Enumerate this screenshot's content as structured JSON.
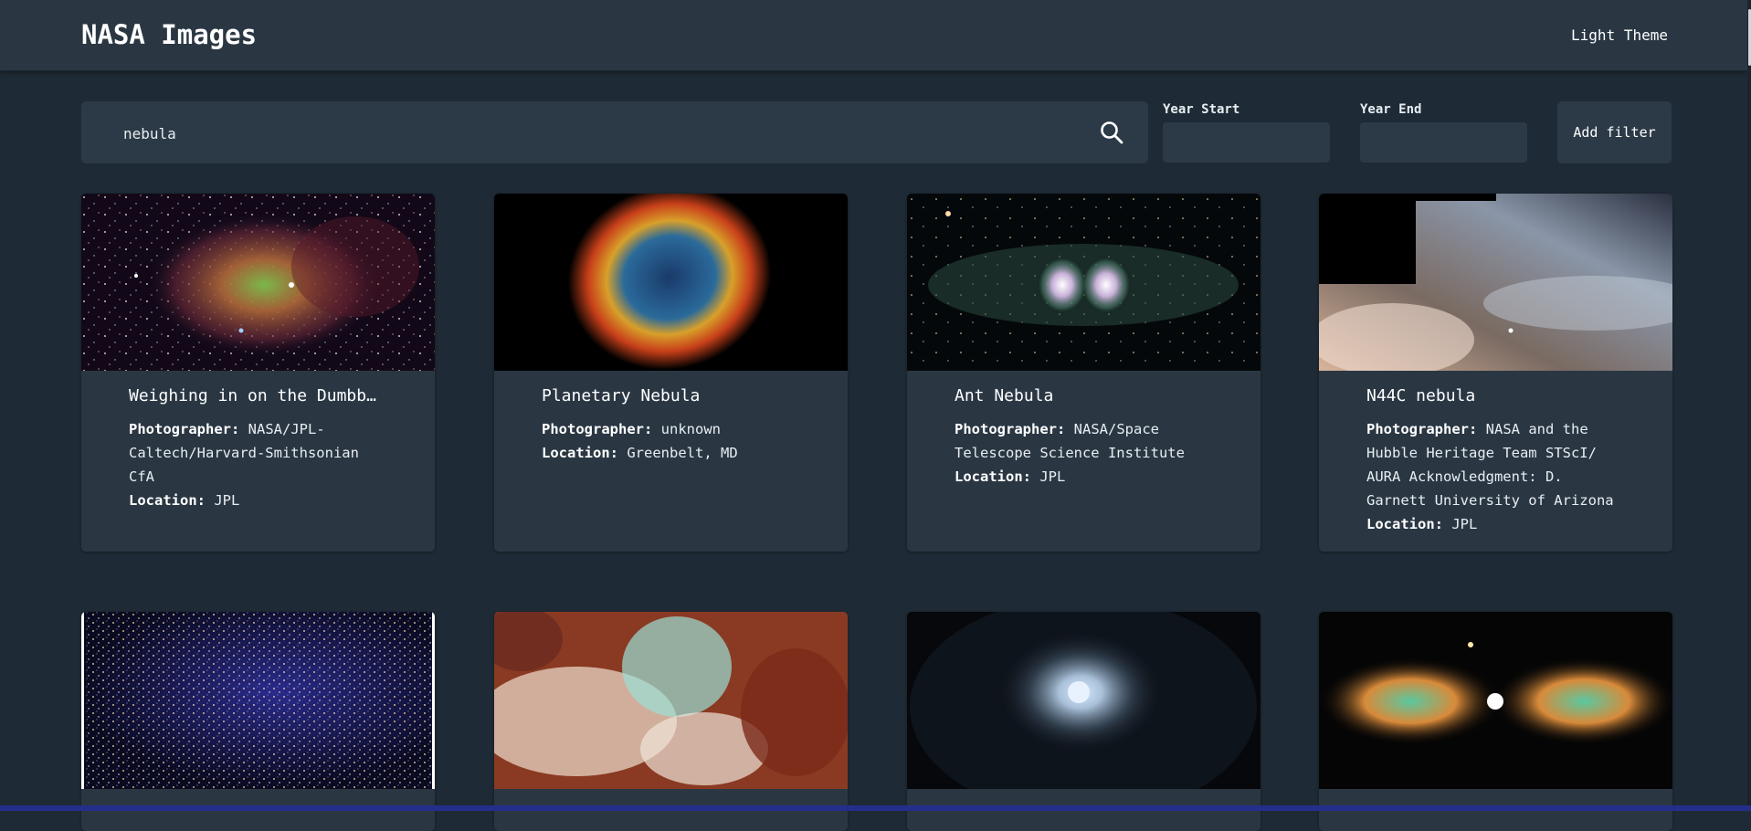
{
  "header": {
    "title": "NASA Images",
    "theme_toggle": "Light Theme"
  },
  "search": {
    "value": "nebula",
    "placeholder": ""
  },
  "filters": {
    "year_start_label": "Year Start",
    "year_end_label": "Year End",
    "add_filter_label": "Add filter"
  },
  "cards": [
    {
      "title": "Weighing in on the Dumbb…",
      "photographer_label": "Photographer:",
      "photographer": "NASA/JPL-Caltech/Harvard-Smithsonian CfA",
      "location_label": "Location:",
      "location": "JPL"
    },
    {
      "title": "Planetary Nebula",
      "photographer_label": "Photographer:",
      "photographer": "unknown",
      "location_label": "Location:",
      "location": "Greenbelt, MD"
    },
    {
      "title": "Ant Nebula",
      "photographer_label": "Photographer:",
      "photographer": "NASA/Space Telescope Science Institute",
      "location_label": "Location:",
      "location": "JPL"
    },
    {
      "title": "N44C nebula",
      "photographer_label": "Photographer:",
      "photographer": "NASA and the Hubble Heritage Team STScI/ AURA Acknowledgment: D. Garnett University of Arizona",
      "location_label": "Location:",
      "location": "JPL"
    }
  ],
  "colors": {
    "background": "#1e2a35",
    "surface": "#2a3743",
    "input": "#2c3a47",
    "text": "#e8edf2"
  }
}
